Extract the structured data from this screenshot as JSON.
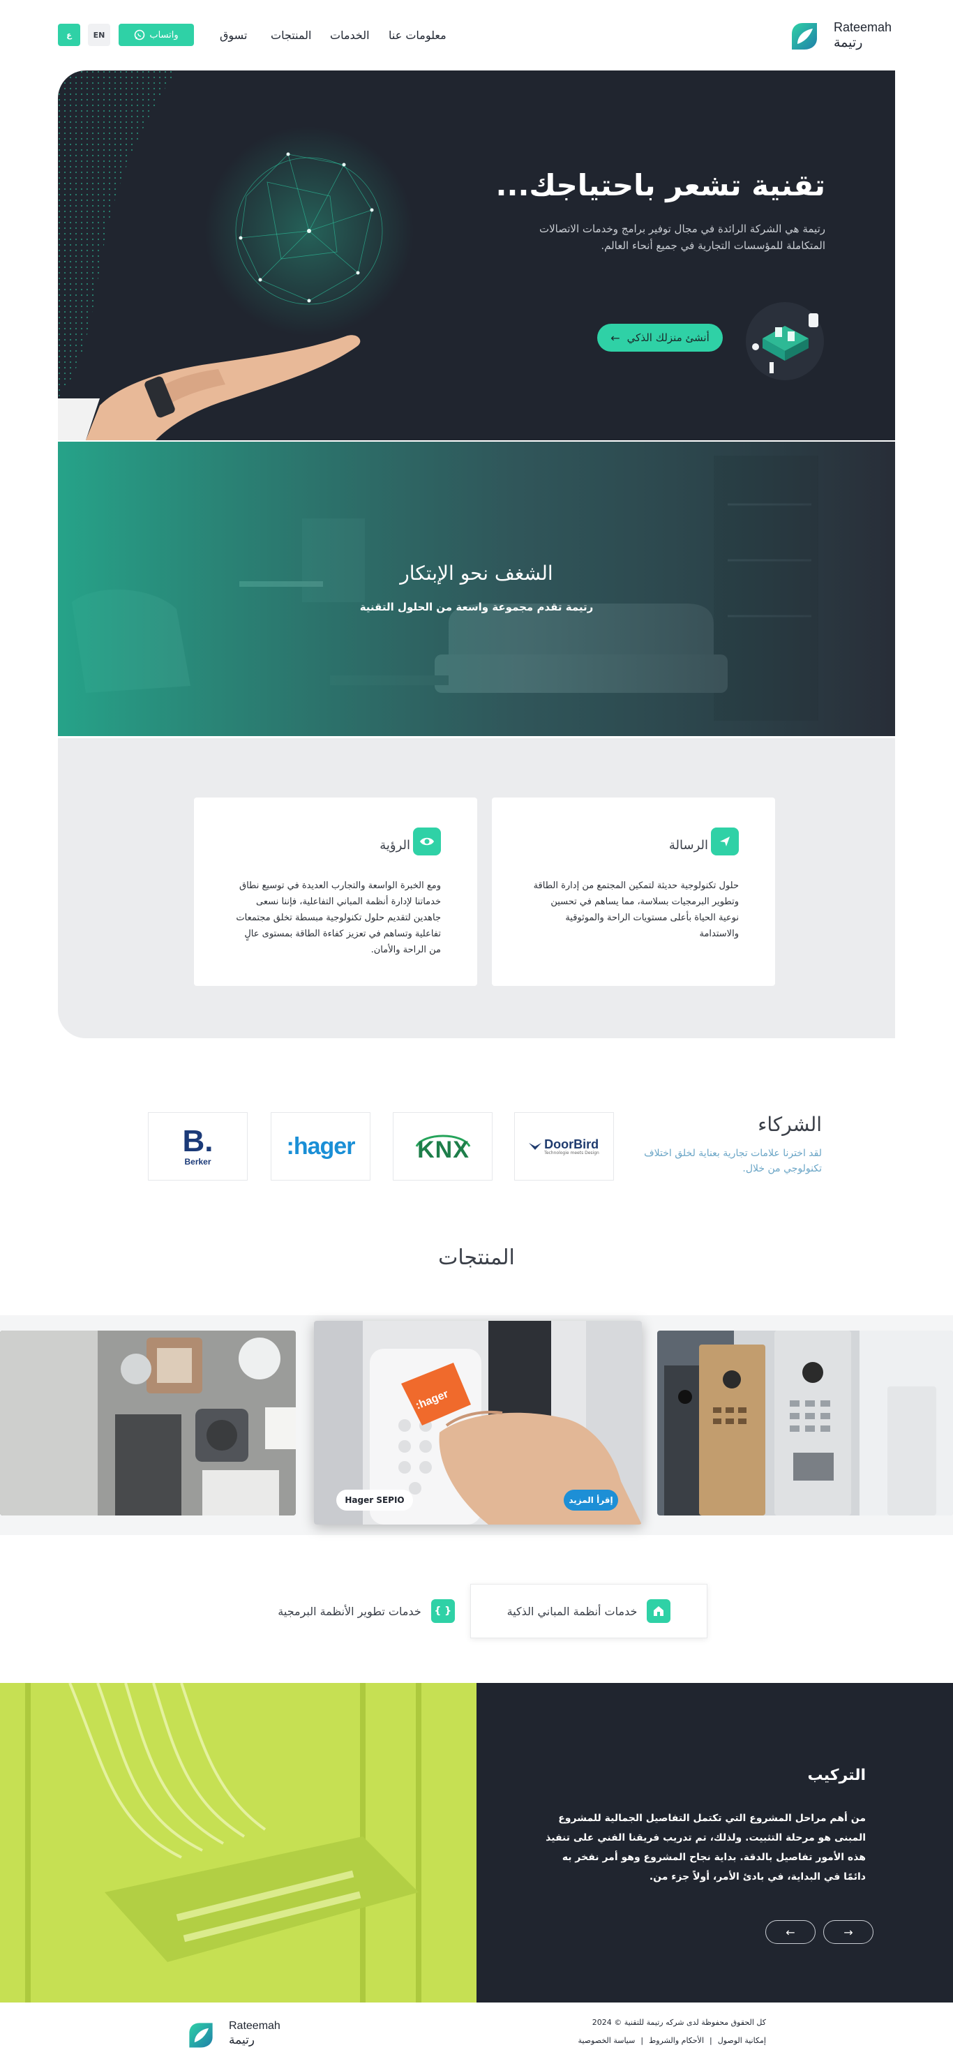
{
  "header": {
    "brand_en": "Rateemah",
    "brand_ar": "رتيمة",
    "nav": [
      "معلومات عنا",
      "الخدمات",
      "المنتجات",
      "تسوق"
    ],
    "whatsapp_label": "واتساب",
    "lang_en": "EN",
    "lang_ar": "ع"
  },
  "hero": {
    "title": "تقنية تشعر باحتياجك...",
    "subtitle": "رتيمة هي الشركة الرائدة في مجال توفير برامج وخدمات الاتصالات المتكاملة للمؤسسات التجارية في جميع أنحاء العالم.",
    "cta": "أنشئ منزلك الذكي"
  },
  "passion": {
    "title": "الشغف نحو الإبتكار",
    "subtitle": "رتيمة تقدم مجموعة واسعة من الحلول التقنية"
  },
  "mission": {
    "title": "الرسالة",
    "body": "حلول تكنولوجية حديثة لتمكين المجتمع من إدارة الطاقة وتطوير البرمجيات بسلاسة، مما يساهم في تحسين نوعية الحياة بأعلى مستويات الراحة والموثوقية والاستدامة"
  },
  "vision": {
    "title": "الرؤية",
    "body": "ومع الخبرة الواسعة والتجارب العديدة في توسيع نطاق خدماتنا لإدارة أنظمة المباني التفاعلية، فإننا نسعى جاهدين لتقديم حلول تكنولوجية مبسطة تخلق مجتمعات تفاعلية وتساهم في تعزيز كفاءة الطاقة بمستوى عالٍ من الراحة والأمان."
  },
  "partners": {
    "title": "الشركاء",
    "subtitle": "لقد اخترنا علامات تجارية بعناية لخلق اختلاف تكنولوجي من خلال.",
    "logos": [
      "DoorBird",
      "Technologie meets Design",
      "KNX",
      ":hager",
      "B.",
      "Berker"
    ]
  },
  "products": {
    "title": "المنتجات",
    "featured_label": "Hager SEPIO",
    "read_more": "إقرأ المزيد",
    "featured_tag": ":hager"
  },
  "services": {
    "tab1": "خدمات أنظمة المباني الذكية",
    "tab2": "خدمات تطوير الأنظمة البرمجية"
  },
  "installation": {
    "title": "التركيب",
    "body": "من أهم مراحل المشروع التي تكتمل التفاصيل الجمالية للمشروع المبنى هو مرحلة التثبيت. ولذلك، تم تدريب فريقنا الفني على تنفيذ هذه الأمور تفاصيل بالدقة. بداية نجاح المشروع وهو أمر نفخر به دائمًا في البداية، في بادئ الأمر، أولاً جزء من."
  },
  "footer": {
    "brand_en": "Rateemah",
    "brand_ar": "رتيمة",
    "copyright": "كل الحقوق محفوظة لدى شركه رتيمة للتقنية © 2024",
    "links": [
      "إمكانية الوصول",
      "الأحكام والشروط",
      "سياسة الخصوصية"
    ]
  },
  "colors": {
    "accent": "#2fd1a6",
    "dark": "#20252f",
    "lime": "#b9d94a",
    "partner_sub": "#6aa5c6",
    "read_more": "#1d8fd6"
  }
}
